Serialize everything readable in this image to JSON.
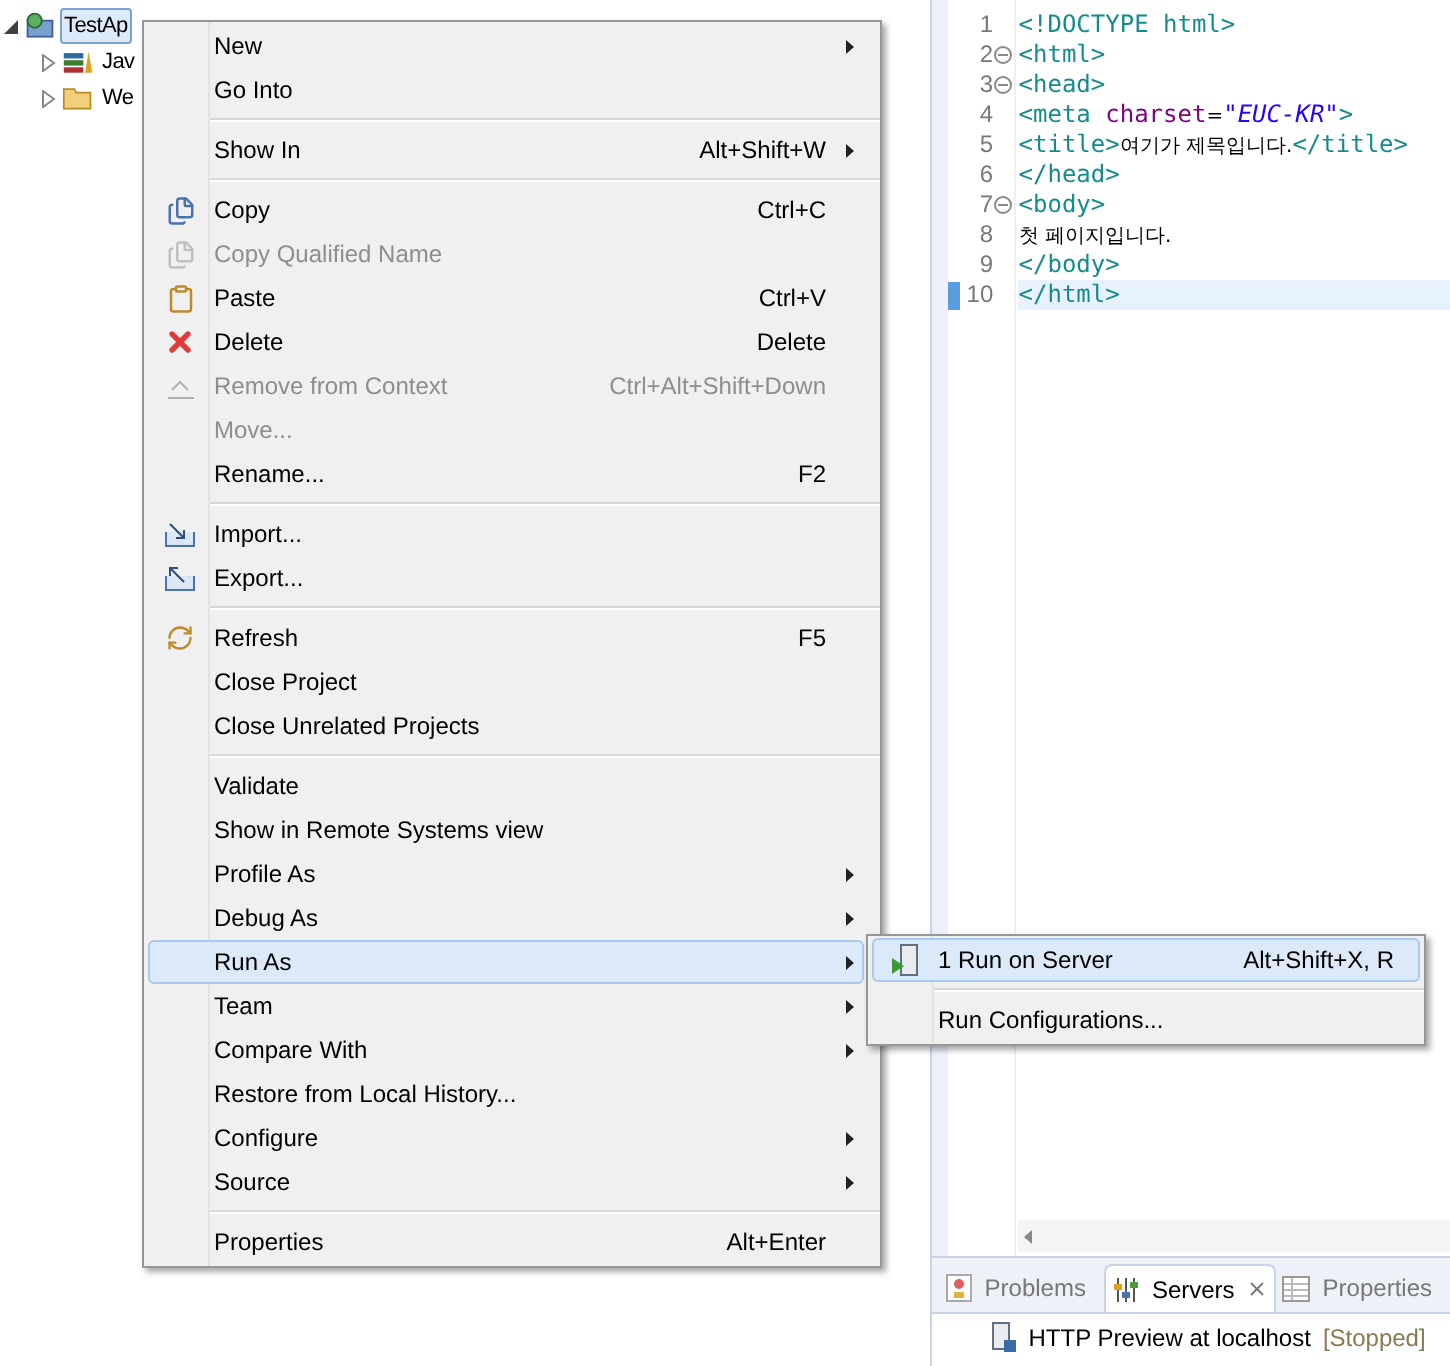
{
  "project_tree": [
    {
      "label": "TestAp",
      "expanded": true,
      "selected": true,
      "children": [
        {
          "label": "Jav",
          "expanded": false,
          "selected": false
        },
        {
          "label": "We",
          "expanded": false,
          "selected": false
        }
      ]
    }
  ],
  "context_menu": {
    "sections": [
      [
        {
          "label": "New",
          "submenu": true,
          "disabled": false,
          "selected": false
        },
        {
          "label": "Go Into",
          "submenu": false,
          "disabled": false,
          "selected": false
        }
      ],
      [
        {
          "label": "Show In",
          "shortcut": "Alt+Shift+W",
          "submenu": true,
          "disabled": false,
          "selected": false
        }
      ],
      [
        {
          "label": "Copy",
          "shortcut": "Ctrl+C",
          "submenu": false,
          "disabled": false,
          "selected": false
        },
        {
          "label": "Copy Qualified Name",
          "submenu": false,
          "disabled": true,
          "selected": false
        },
        {
          "label": "Paste",
          "shortcut": "Ctrl+V",
          "submenu": false,
          "disabled": false,
          "selected": false
        },
        {
          "label": "Delete",
          "shortcut": "Delete",
          "submenu": false,
          "disabled": false,
          "selected": false
        },
        {
          "label": "Remove from Context",
          "shortcut": "Ctrl+Alt+Shift+Down",
          "submenu": false,
          "disabled": true,
          "selected": false
        },
        {
          "label": "Move...",
          "submenu": false,
          "disabled": true,
          "selected": false
        },
        {
          "label": "Rename...",
          "shortcut": "F2",
          "submenu": false,
          "disabled": false,
          "selected": false
        }
      ],
      [
        {
          "label": "Import...",
          "submenu": false,
          "disabled": false,
          "selected": false
        },
        {
          "label": "Export...",
          "submenu": false,
          "disabled": false,
          "selected": false
        }
      ],
      [
        {
          "label": "Refresh",
          "shortcut": "F5",
          "submenu": false,
          "disabled": false,
          "selected": false
        },
        {
          "label": "Close Project",
          "submenu": false,
          "disabled": false,
          "selected": false
        },
        {
          "label": "Close Unrelated Projects",
          "submenu": false,
          "disabled": false,
          "selected": false
        }
      ],
      [
        {
          "label": "Validate",
          "submenu": false,
          "disabled": false,
          "selected": false
        },
        {
          "label": "Show in Remote Systems view",
          "submenu": false,
          "disabled": false,
          "selected": false
        },
        {
          "label": "Profile As",
          "submenu": true,
          "disabled": false,
          "selected": false
        },
        {
          "label": "Debug As",
          "submenu": true,
          "disabled": false,
          "selected": false
        },
        {
          "label": "Run As",
          "submenu": true,
          "disabled": false,
          "selected": true
        },
        {
          "label": "Team",
          "submenu": true,
          "disabled": false,
          "selected": false
        },
        {
          "label": "Compare With",
          "submenu": true,
          "disabled": false,
          "selected": false
        },
        {
          "label": "Restore from Local History...",
          "submenu": false,
          "disabled": false,
          "selected": false
        },
        {
          "label": "Configure",
          "submenu": true,
          "disabled": false,
          "selected": false
        },
        {
          "label": "Source",
          "submenu": true,
          "disabled": false,
          "selected": false
        }
      ],
      [
        {
          "label": "Properties",
          "shortcut": "Alt+Enter",
          "submenu": false,
          "disabled": false,
          "selected": false
        }
      ]
    ]
  },
  "run_as_submenu": {
    "sections": [
      [
        {
          "label": "1 Run on Server",
          "shortcut": "Alt+Shift+X, R",
          "selected": true
        }
      ],
      [
        {
          "label": "Run Configurations...",
          "selected": false
        }
      ]
    ]
  },
  "editor": {
    "lines": [
      {
        "number": "1",
        "fold": false,
        "current": false,
        "tokens": [
          {
            "kind": "tag",
            "text": "<!DOCTYPE html>"
          }
        ]
      },
      {
        "number": "2",
        "fold": true,
        "current": false,
        "tokens": [
          {
            "kind": "tag",
            "text": "<html>"
          }
        ]
      },
      {
        "number": "3",
        "fold": true,
        "current": false,
        "tokens": [
          {
            "kind": "tag",
            "text": "<head>"
          }
        ]
      },
      {
        "number": "4",
        "fold": false,
        "current": false,
        "tokens": [
          {
            "kind": "tag",
            "text": "<meta "
          },
          {
            "kind": "attr",
            "text": "charset"
          },
          {
            "kind": "text",
            "text": "="
          },
          {
            "kind": "value",
            "text": "\"EUC-KR\""
          },
          {
            "kind": "tag",
            "text": ">"
          }
        ]
      },
      {
        "number": "5",
        "fold": false,
        "current": false,
        "tokens": [
          {
            "kind": "tag",
            "text": "<title>"
          },
          {
            "kind": "text",
            "text": "여기가 제목입니다."
          },
          {
            "kind": "tag",
            "text": "</title>"
          }
        ]
      },
      {
        "number": "6",
        "fold": false,
        "current": false,
        "tokens": [
          {
            "kind": "tag",
            "text": "</head>"
          }
        ]
      },
      {
        "number": "7",
        "fold": true,
        "current": false,
        "tokens": [
          {
            "kind": "tag",
            "text": "<body>"
          }
        ]
      },
      {
        "number": "8",
        "fold": false,
        "current": false,
        "tokens": [
          {
            "kind": "text",
            "text": "첫 페이지입니다."
          }
        ]
      },
      {
        "number": "9",
        "fold": false,
        "current": false,
        "tokens": [
          {
            "kind": "tag",
            "text": "</body>"
          }
        ]
      },
      {
        "number": "10",
        "fold": false,
        "current": true,
        "tokens": [
          {
            "kind": "tag",
            "text": "</html>"
          }
        ]
      }
    ]
  },
  "bottom_panel": {
    "tabs": [
      {
        "label": "Problems",
        "selected": false,
        "closable": false
      },
      {
        "label": "Servers",
        "selected": true,
        "closable": true
      },
      {
        "label": "Properties",
        "selected": false,
        "closable": false
      }
    ],
    "servers": [
      {
        "name": "HTTP Preview at localhost",
        "status": "[Stopped]"
      }
    ]
  }
}
